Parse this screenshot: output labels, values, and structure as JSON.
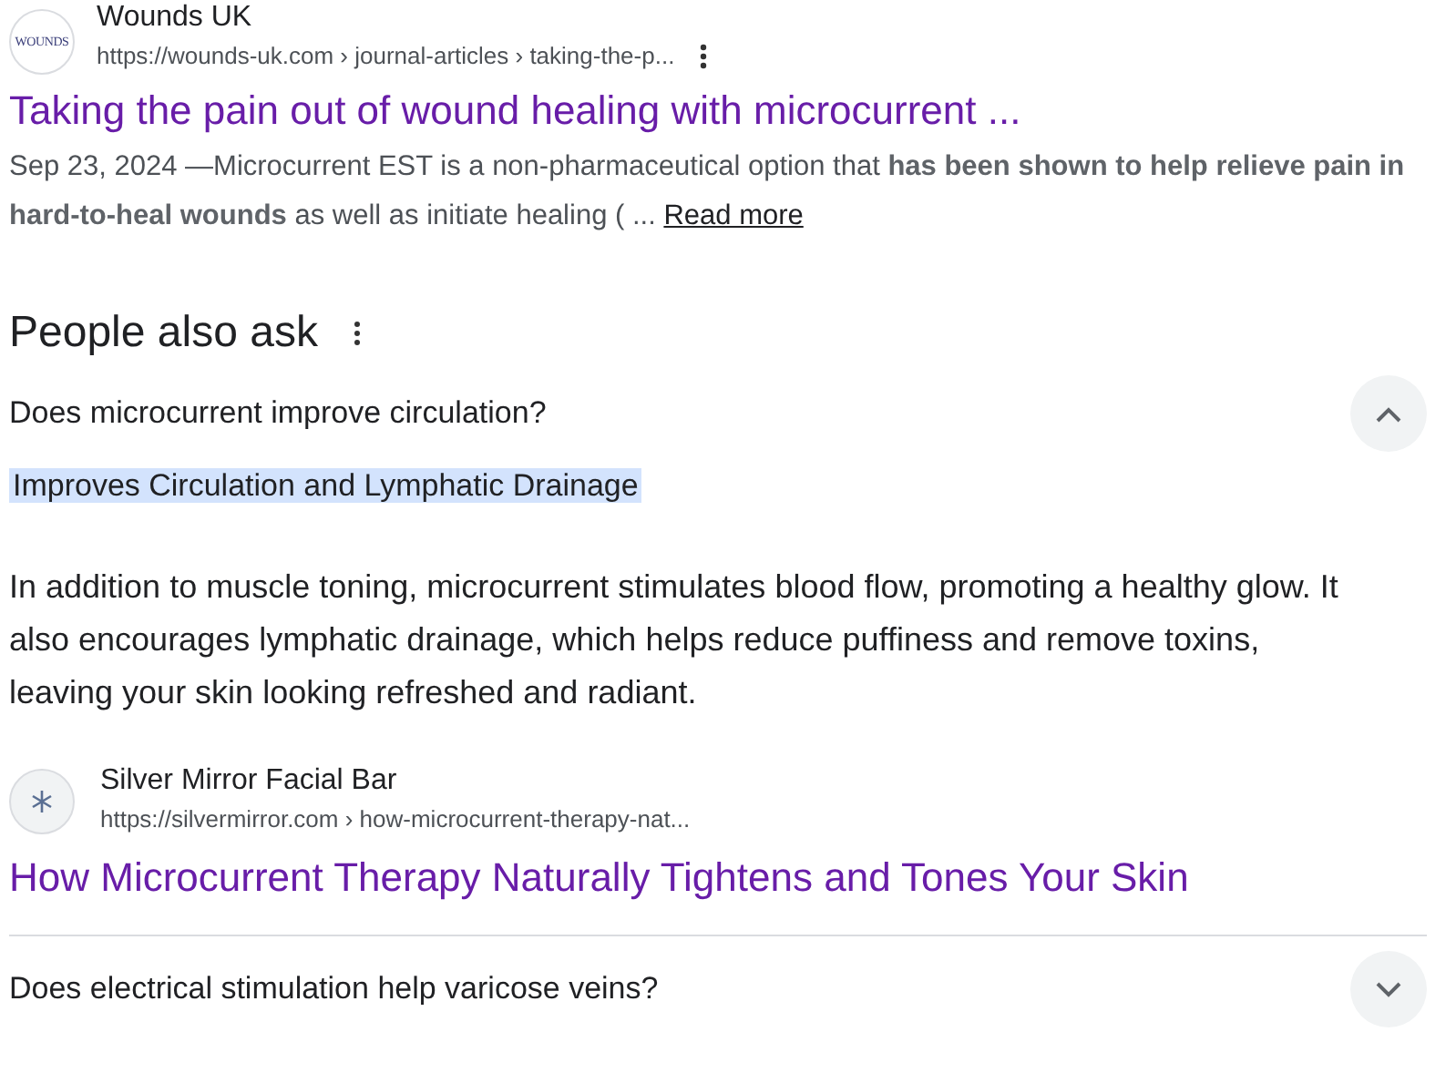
{
  "result": {
    "favicon_text": "WOUNDS",
    "site": "Wounds UK",
    "url": "https://wounds-uk.com › journal-articles › taking-the-p...",
    "title": "Taking the pain out of wound healing with microcurrent ...",
    "date": "Sep 23, 2024 —",
    "snippet": "Microcurrent EST is a non-pharmaceutical option that **has been shown to help relieve pain in hard-to-heal wounds** as well as initiate healing ( ...",
    "read_more": "Read more"
  },
  "people_also_ask": {
    "heading": "People also ask",
    "questions": [
      {
        "question": "Does microcurrent improve circulation?",
        "expanded": true,
        "answer_heading": "Improves Circulation and Lymphatic Drainage",
        "answer": "In addition to muscle toning, microcurrent stimulates blood flow, promoting a healthy glow. It also encourages lymphatic drainage, which helps reduce puffiness and remove toxins, leaving your skin looking refreshed and radiant.",
        "source": {
          "site": "Silver Mirror Facial Bar",
          "url": "https://silvermirror.com › how-microcurrent-therapy-nat...",
          "title": "How Microcurrent Therapy Naturally Tightens and Tones Your Skin"
        }
      },
      {
        "question": "Does electrical stimulation help varicose veins?",
        "expanded": false
      }
    ]
  }
}
